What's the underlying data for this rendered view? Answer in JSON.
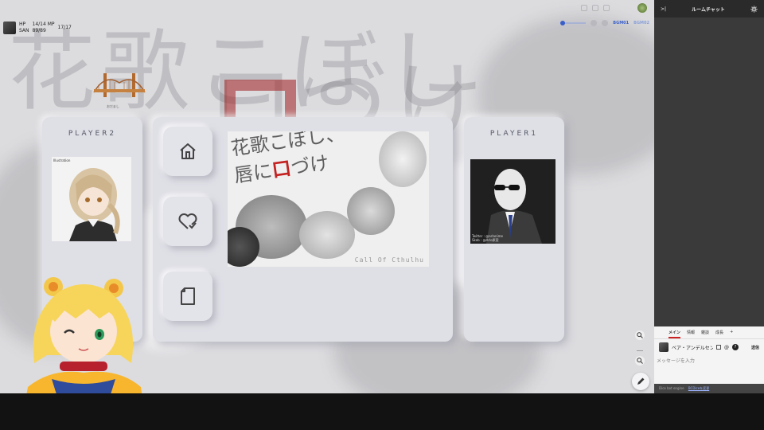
{
  "board": {
    "topline": "",
    "bg_title_1": "花歌こぼし",
    "bg_title_2": "ロづけ",
    "status": {
      "hp_label": "HP",
      "hp_value": "14/14",
      "mp_label": "MP",
      "mp_value": "17/17",
      "san_label": "SAN",
      "san_value": "89/89"
    },
    "toolbar": {
      "bgm_label": "BGM01",
      "bgm2_label": "BGM02"
    },
    "bridge_label": "おだまし"
  },
  "panels": {
    "p2_title": "PLAYER2",
    "p1_title": "PLAYER1",
    "p2_name": "Illustration",
    "p1_credit_1": "Twitter : @arlanime",
    "p1_credit_2": "Skeb : @Arlo原案"
  },
  "scenario": {
    "title_line1": "花歌こぼし、",
    "title_line2_a": "唇に",
    "title_line2_b": "口",
    "title_line2_c": "づけ",
    "subtitle": "Call Of Cthulhu"
  },
  "sidebar": {
    "title": "ルームチャット",
    "collapse_icon": ">|",
    "tabs": [
      "メイン",
      "情報",
      "雑談",
      "成長",
      "+"
    ],
    "speaker_name": "ベア・アンデルセン",
    "send_label": "送信",
    "input_placeholder": "メッセージを入力",
    "footer_text": "Dice bot engine",
    "footer_link": "BCDiceを変更"
  },
  "colors": {
    "accent": "#3b5fc9",
    "panel": "#dfdfe6",
    "sidebar": "#3c3c3c",
    "tab_active": "#cc2222"
  }
}
